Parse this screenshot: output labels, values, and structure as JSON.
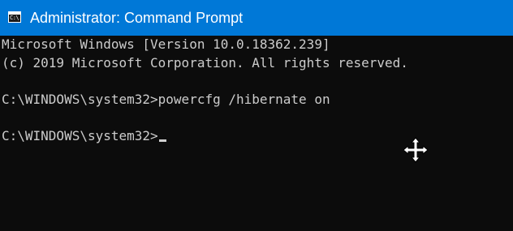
{
  "window": {
    "title": "Administrator: Command Prompt",
    "icon": "cmd-console-icon",
    "icon_label": "C:\\.",
    "accent_color": "#0078d7",
    "background_color": "#0c0c0c",
    "text_color": "#cccccc"
  },
  "console": {
    "lines": [
      "Microsoft Windows [Version 10.0.18362.239]",
      "(c) 2019 Microsoft Corporation. All rights reserved.",
      "",
      "C:\\WINDOWS\\system32>powercfg /hibernate on",
      "",
      "C:\\WINDOWS\\system32>"
    ]
  },
  "pointer": {
    "icon": "move-cursor-icon"
  }
}
